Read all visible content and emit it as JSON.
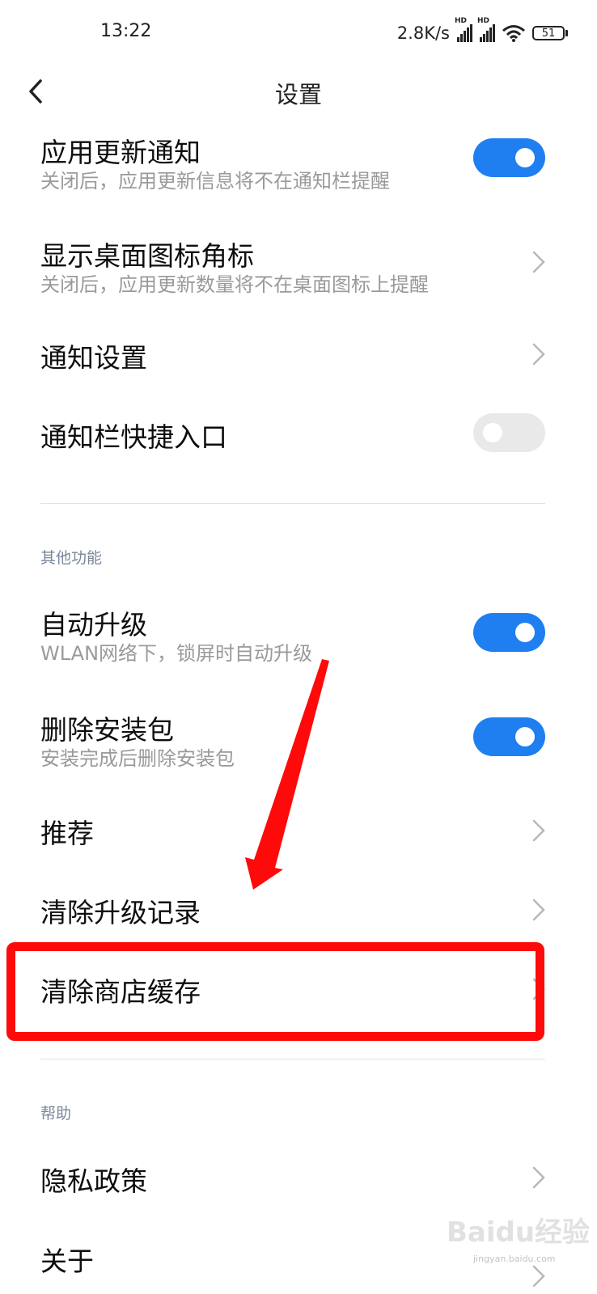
{
  "status_bar": {
    "time": "13:22",
    "net_speed": "2.8K/s",
    "signal_1_label": "HD",
    "signal_2_label": "HD",
    "battery": "51"
  },
  "header": {
    "title": "设置",
    "back_icon": "chevron-left-icon"
  },
  "settings": {
    "app_update_notify": {
      "title": "应用更新通知",
      "subtitle": "关闭后，应用更新信息将不在通知栏提醒",
      "toggle": "on"
    },
    "desktop_badge": {
      "title": "显示桌面图标角标",
      "subtitle": "关闭后，应用更新数量将不在桌面图标上提醒"
    },
    "notification_settings": {
      "title": "通知设置"
    },
    "notification_shortcut": {
      "title": "通知栏快捷入口",
      "toggle": "off"
    }
  },
  "other_section": {
    "header": "其他功能",
    "auto_upgrade": {
      "title": "自动升级",
      "subtitle": "WLAN网络下，锁屏时自动升级",
      "toggle": "on"
    },
    "delete_package": {
      "title": "删除安装包",
      "subtitle": "安装完成后删除安装包",
      "toggle": "on"
    },
    "recommend": {
      "title": "推荐"
    },
    "clear_upgrade_records": {
      "title": "清除升级记录"
    },
    "clear_store_cache": {
      "title": "清除商店缓存"
    }
  },
  "help_section": {
    "header": "帮助",
    "privacy_policy": {
      "title": "隐私政策"
    },
    "about": {
      "title": "关于"
    }
  },
  "colors": {
    "accent": "#1f7ff0",
    "annotation": "#ff0a0a",
    "toggle_off": "#e9e9e9"
  },
  "watermark": {
    "logo": "Baidu经验",
    "url": "jingyan.baidu.com"
  }
}
